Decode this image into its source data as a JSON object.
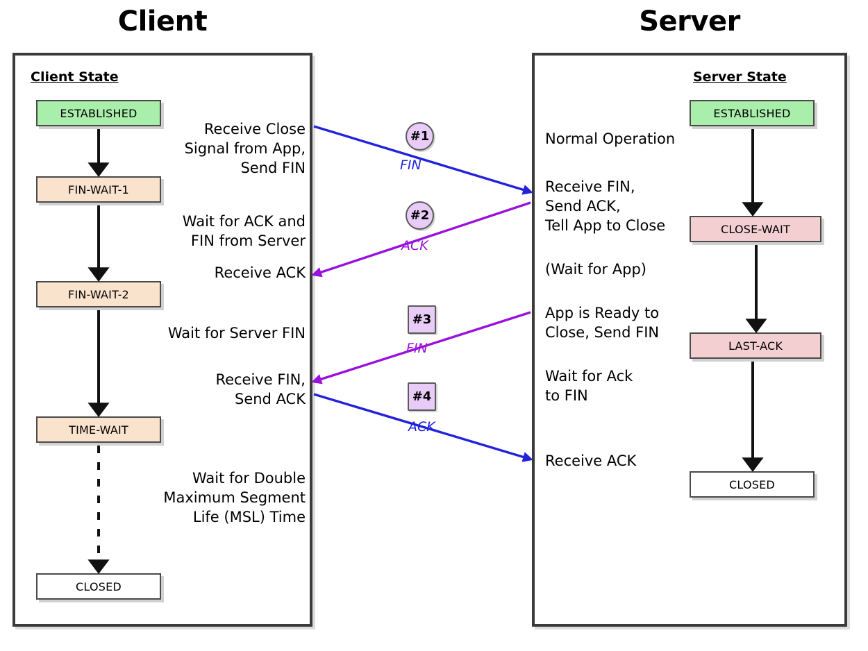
{
  "diagram": {
    "title_client": "Client",
    "title_server": "Server",
    "colors": {
      "established": "#a9eeab",
      "finwait": "#fae3cd",
      "closewait": "#f4cfd2",
      "closed": "#ffffff",
      "marker": "#e8ccf7",
      "blue": "#2222dd",
      "purple": "#9911dd",
      "border": "#3b3b3b"
    }
  },
  "client": {
    "heading": "Client State",
    "states": [
      {
        "label": "ESTABLISHED",
        "color": "#a9eeab"
      },
      {
        "label": "FIN-WAIT-1",
        "color": "#fae3cd"
      },
      {
        "label": "FIN-WAIT-2",
        "color": "#fae3cd"
      },
      {
        "label": "TIME-WAIT",
        "color": "#fae3cd"
      },
      {
        "label": "CLOSED",
        "color": "#ffffff"
      }
    ],
    "notes": [
      "Receive Close\nSignal from App,\nSend FIN",
      "Wait for ACK and\nFIN from Server",
      "Receive ACK",
      "Wait for Server FIN",
      "Receive FIN,\nSend ACK",
      "Wait for Double\nMaximum Segment\nLife (MSL) Time"
    ]
  },
  "server": {
    "heading": "Server State",
    "states": [
      {
        "label": "ESTABLISHED",
        "color": "#a9eeab"
      },
      {
        "label": "CLOSE-WAIT",
        "color": "#f4cfd2"
      },
      {
        "label": "LAST-ACK",
        "color": "#f4cfd2"
      },
      {
        "label": "CLOSED",
        "color": "#ffffff"
      }
    ],
    "notes": [
      "Normal Operation",
      "Receive FIN,\nSend ACK,\nTell App to Close",
      "(Wait for App)",
      "App is Ready to\nClose, Send FIN",
      "Wait for Ack\nto FIN",
      "Receive ACK"
    ]
  },
  "messages": [
    {
      "marker": "#1",
      "shape": "circle",
      "label": "FIN",
      "color": "#2222dd",
      "direction": "client-to-server"
    },
    {
      "marker": "#2",
      "shape": "circle",
      "label": "ACK",
      "color": "#9911dd",
      "direction": "server-to-client"
    },
    {
      "marker": "#3",
      "shape": "square",
      "label": "FIN",
      "color": "#9911dd",
      "direction": "server-to-client"
    },
    {
      "marker": "#4",
      "shape": "square",
      "label": "ACK",
      "color": "#2222dd",
      "direction": "client-to-server"
    }
  ]
}
